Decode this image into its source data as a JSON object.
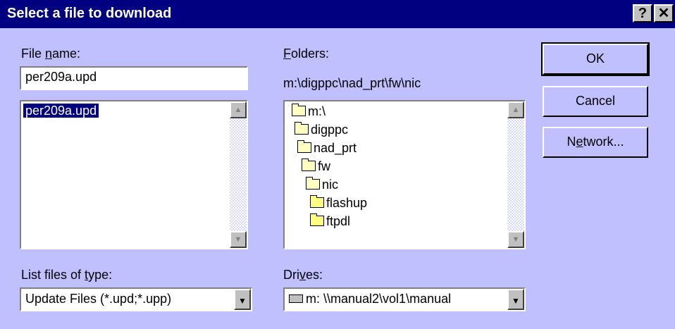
{
  "window": {
    "title": "Select a file to download",
    "help_label": "?",
    "close_label": "✕"
  },
  "file_name": {
    "label_pre": "File ",
    "label_accel": "n",
    "label_post": "ame:",
    "value": "per209a.upd"
  },
  "file_list": {
    "items": [
      "per209a.upd"
    ]
  },
  "folders": {
    "label_accel": "F",
    "label_post": "olders:",
    "path": "m:\\digppc\\nad_prt\\fw\\nic",
    "tree": [
      "m:\\",
      "digppc",
      "nad_prt",
      "fw",
      "nic",
      "flashup",
      "ftpdl"
    ]
  },
  "file_type": {
    "label_pre": "List files of ",
    "label_accel": "t",
    "label_post": "ype:",
    "value": "Update Files (*.upd;*.upp)"
  },
  "drives": {
    "label_pre": "Dri",
    "label_accel": "v",
    "label_post": "es:",
    "value": "m: \\\\manual2\\vol1\\manual"
  },
  "buttons": {
    "ok": "OK",
    "cancel": "Cancel",
    "network_pre": "N",
    "network_accel": "e",
    "network_post": "twork..."
  },
  "colors": {
    "title_bar": "#000080",
    "dialog_bg": "#c0c0ff",
    "selection": "#000080"
  }
}
